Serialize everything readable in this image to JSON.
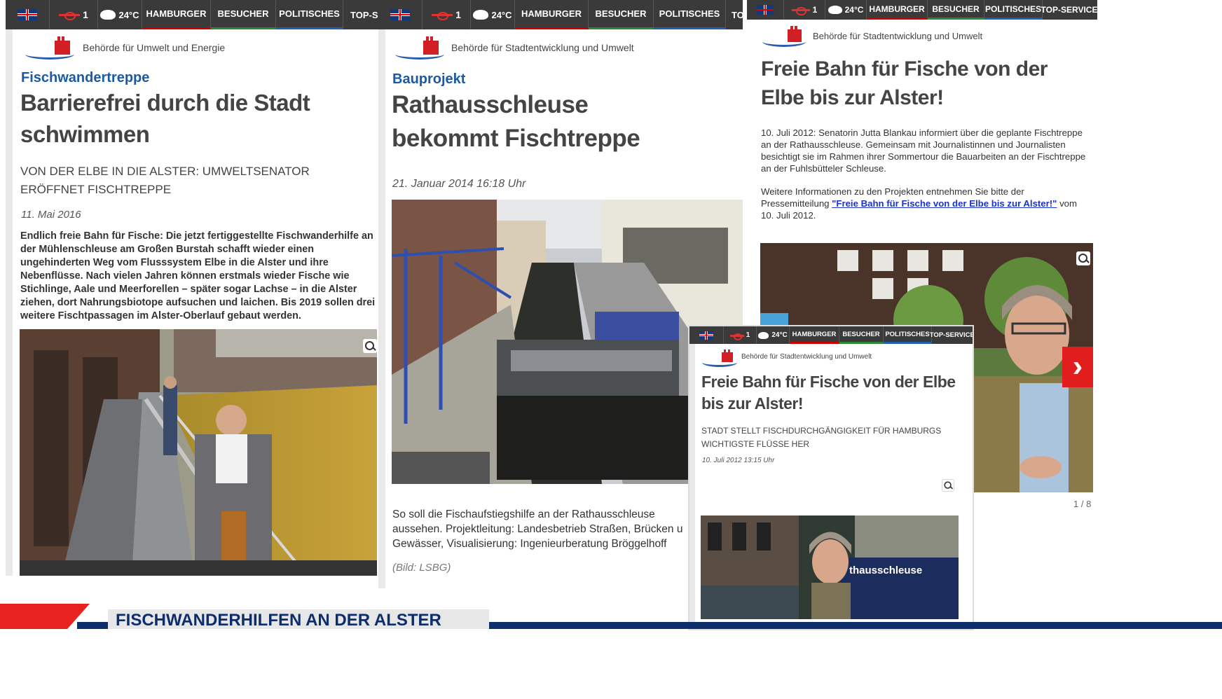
{
  "nav": {
    "language_icon": "uk-flag-icon",
    "lines_count": "1",
    "temperature": "24°C",
    "items": [
      "HAMBURGER",
      "BESUCHER",
      "POLITISCHES",
      "TOP-SERVICES"
    ],
    "items_cut_1": "TOP-SE",
    "items_cut_2": "TO",
    "colors": {
      "hamburger": "#c00000",
      "besucher": "#2a8a3a",
      "politisches": "#1f5fb0"
    }
  },
  "panel1": {
    "authority": "Behörde für Umwelt und Energie",
    "kicker": "Fischwandertreppe",
    "headline": "Barrierefrei durch die Stadt schwimmen",
    "subheadline": "VON DER ELBE IN DIE ALSTER: UMWELTSENATOR ERÖFFNET FISCHTREPPE",
    "date": "11. Mai 2016",
    "body": "Endlich freie Bahn für Fische:  Die jetzt fertiggestellte Fischwanderhilfe an der Mühlenschleuse am Großen Burstah schafft wieder einen ungehinderten Weg vom Flusssystem Elbe in die Alster und ihre Nebenflüsse. Nach vielen Jahren können erstmals wieder Fische wie Stichlinge, Aale und Meerforellen – später sogar Lachse – in die Alster ziehen, dort Nahrungsbiotope aufsuchen und laichen. Bis 2019 sollen drei weitere Fischtpassagen im Alster-Oberlauf gebaut werden."
  },
  "panel2": {
    "authority": "Behörde für Stadtentwicklung und Umwelt",
    "kicker": "Bauprojekt",
    "headline": "Rathausschleuse bekommt Fischtreppe",
    "date": "21. Januar 2014 16:18 Uhr",
    "caption": "So soll die Fischaufstiegshilfe an der Rathausschleuse aussehen.  Projektleitung: Landesbetrieb Straßen, Brücken u Gewässer,  Visualisierung: Ingenieurberatung Bröggelhoff",
    "credit": "(Bild: LSBG)"
  },
  "panel3": {
    "authority": "Behörde für Stadtentwicklung und Umwelt",
    "headline": "Freie Bahn für Fische von der Elbe bis zur Alster!",
    "para1": "10. Juli 2012: Senatorin Jutta Blankau informiert über die geplante Fischtreppe an der Rathausschleuse. Gemeinsam mit Journalistinnen und Journalisten besichtigt sie im Rahmen ihrer Sommertour die Bauarbeiten an der Fischtreppe an der Fuhlsbütteler Schleuse.",
    "para2_before": "Weitere Informationen zu den Projekten entnehmen Sie bitte der Pressemitteilung ",
    "para2_link": "\"Freie Bahn für Fische von der Elbe bis zur Alster!\"",
    "para2_after": " vom 10. Juli 2012.",
    "counter": "1 / 8"
  },
  "panel4": {
    "authority": "Behörde für Stadtentwicklung und Umwelt",
    "headline": "Freie Bahn für Fische von der Elbe bis zur Alster!",
    "subheadline": "STADT STELLT FISCHDURCHGÄNGIGKEIT FÜR HAMBURGS WICHTIGSTE FLÜSSE HER",
    "date": "10. Juli 2012 13:15 Uhr",
    "sign_text": "thausschleuse"
  },
  "banner": {
    "title": "FISCHWANDERHILFEN AN DER ALSTER",
    "colors": {
      "red": "#e8231f",
      "navy": "#0d2d6b"
    }
  }
}
